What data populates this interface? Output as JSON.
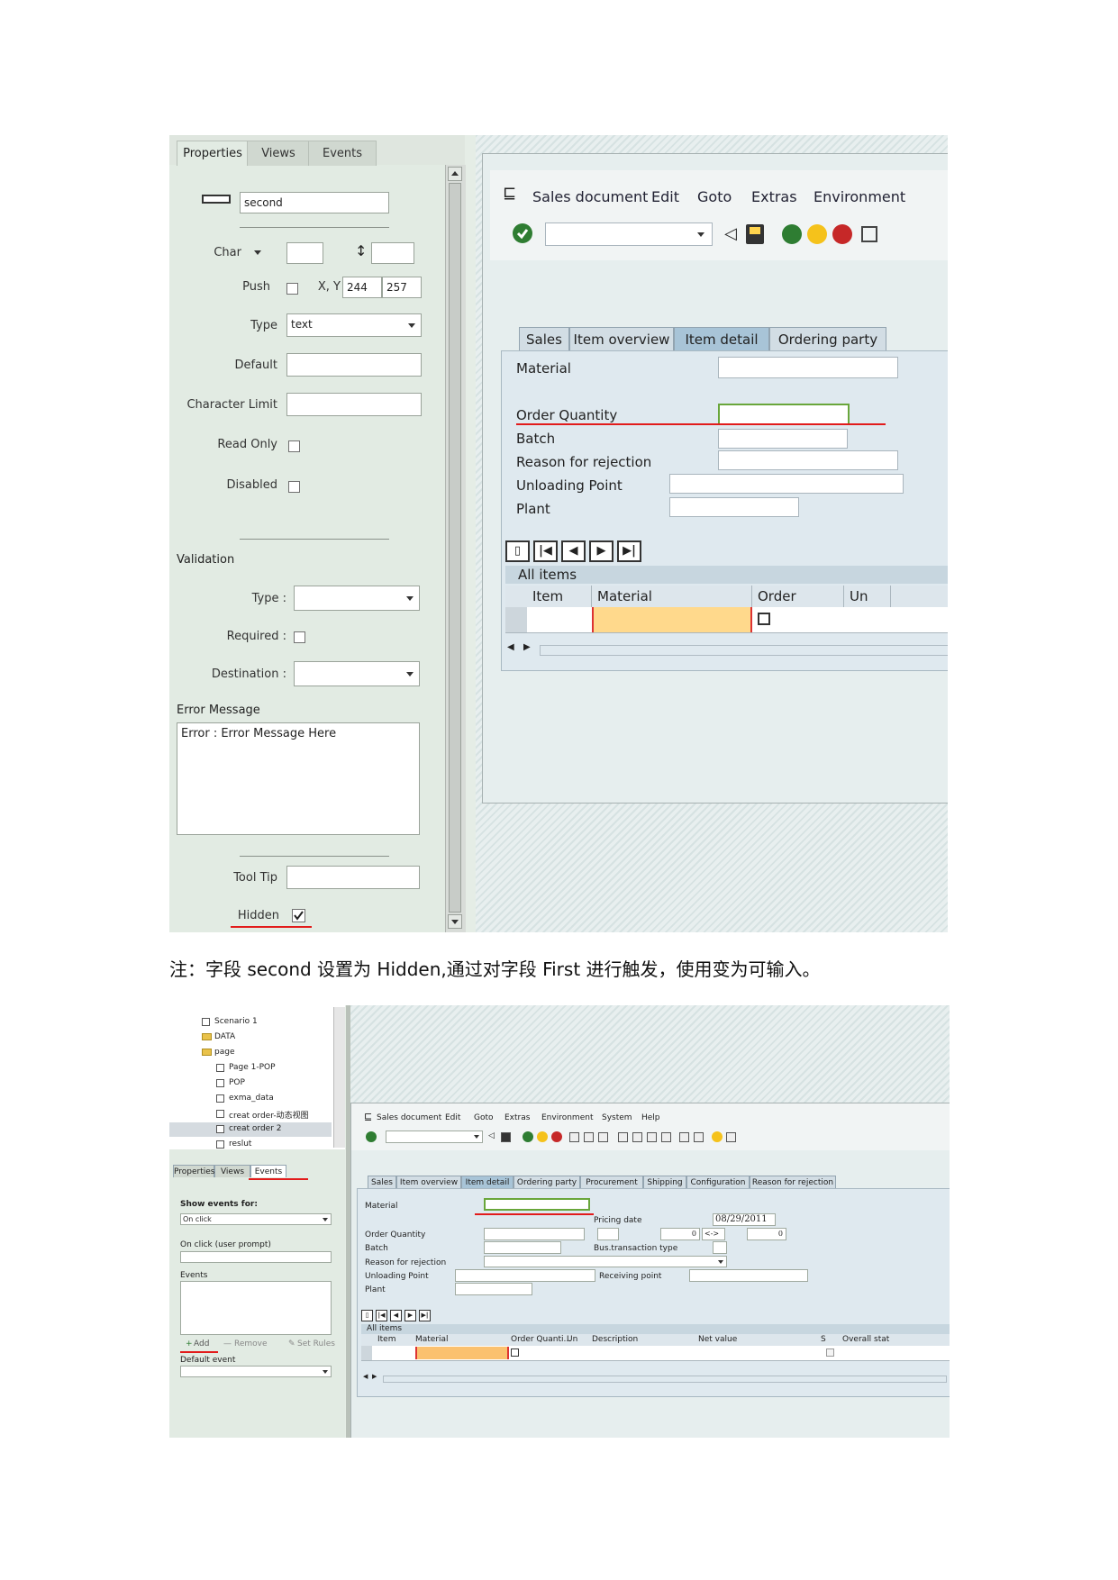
{
  "caption": "注：字段 second 设置为 Hidden,通过对字段 First 进行触发，使用变为可输入。",
  "shot1": {
    "tabs": [
      "Properties",
      "Views",
      "Events"
    ],
    "field_name": "second",
    "char_label": "Char",
    "push_label": "Push",
    "xy_label": "X, Y",
    "x_value": "244",
    "y_value": "257",
    "type_label": "Type",
    "type_value": "text",
    "default_label": "Default",
    "char_limit_label": "Character Limit",
    "read_only_label": "Read Only",
    "disabled_label": "Disabled",
    "validation_label": "Validation",
    "v_type_label": "Type :",
    "required_label": "Required :",
    "destination_label": "Destination :",
    "error_message_label": "Error Message",
    "error_message_value": "Error : Error Message Here",
    "tooltip_label": "Tool Tip",
    "hidden_label": "Hidden",
    "sap": {
      "menu": [
        "Sales document",
        "Edit",
        "Goto",
        "Extras",
        "Environment"
      ],
      "tabs": [
        "Sales",
        "Item overview",
        "Item detail",
        "Ordering party"
      ],
      "fields": [
        "Material",
        "Order Quantity",
        "Batch",
        "Reason for rejection",
        "Unloading Point",
        "Plant"
      ],
      "table_title": "All items",
      "columns": [
        "Item",
        "Material",
        "Order Quanti...",
        "Un"
      ]
    }
  },
  "shot2": {
    "tree": [
      "Scenario 1",
      "DATA",
      "page",
      "Page 1-POP",
      "POP",
      "exma_data",
      "creat order-动态视图",
      "creat order 2",
      "reslut"
    ],
    "tabs": [
      "Properties",
      "Views",
      "Events"
    ],
    "show_events_label": "Show events for:",
    "show_events_value": "On click",
    "on_click_prompt_label": "On click (user prompt)",
    "events_label": "Events",
    "add_label": "Add",
    "remove_label": "Remove",
    "set_rules_label": "Set Rules",
    "default_event_label": "Default event",
    "sap": {
      "menu": [
        "Sales document",
        "Edit",
        "Goto",
        "Extras",
        "Environment",
        "System",
        "Help"
      ],
      "tabs": [
        "Sales",
        "Item overview",
        "Item detail",
        "Ordering party",
        "Procurement",
        "Shipping",
        "Configuration",
        "Reason for rejection"
      ],
      "material_label": "Material",
      "pricing_date_label": "Pricing date",
      "pricing_date_value": "08/29/2011",
      "order_quantity_label": "Order Quantity",
      "qty_value_1": "0",
      "arrow_value": "<->",
      "qty_value_2": "0",
      "batch_label": "Batch",
      "bus_transaction_label": "Bus.transaction type",
      "reason_label": "Reason for rejection",
      "unloading_label": "Unloading Point",
      "receiving_label": "Receiving point",
      "plant_label": "Plant",
      "table_title": "All items",
      "columns": [
        "Item",
        "Material",
        "Order Quanti...",
        "Un",
        "Description",
        "Net value",
        "S",
        "Overall stat"
      ]
    }
  }
}
